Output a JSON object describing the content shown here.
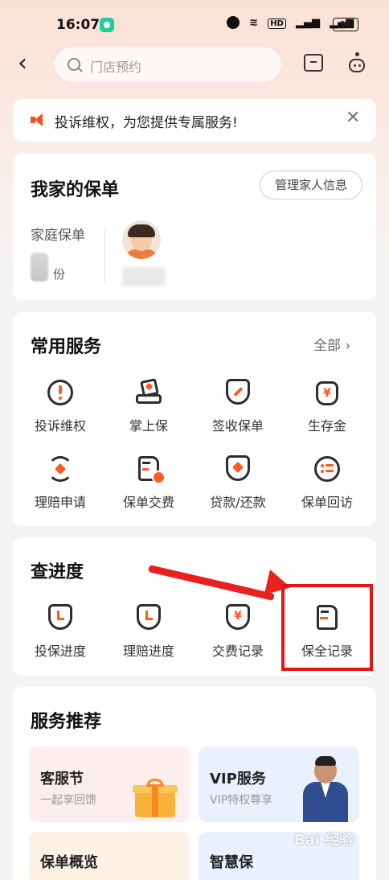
{
  "status": {
    "time": "16:07",
    "battery": "96",
    "net_label": "HD"
  },
  "nav": {
    "search_placeholder": "门店预约"
  },
  "notice": {
    "text": "投诉维权，为您提供专属服务!"
  },
  "policy": {
    "title": "我家的保单",
    "manage_label": "管理家人信息",
    "family_label": "家庭保单",
    "count_unit": "份"
  },
  "common": {
    "title": "常用服务",
    "all_label": "全部",
    "items": [
      {
        "label": "投诉维权",
        "icon": "alert-circle-icon"
      },
      {
        "label": "掌上保",
        "icon": "hand-document-icon"
      },
      {
        "label": "签收保单",
        "icon": "shield-pen-icon"
      },
      {
        "label": "生存金",
        "icon": "money-bag-icon"
      },
      {
        "label": "理赔申请",
        "icon": "refresh-claim-icon"
      },
      {
        "label": "保单交费",
        "icon": "document-pay-icon"
      },
      {
        "label": "贷款/还款",
        "icon": "shield-loan-icon"
      },
      {
        "label": "保单回访",
        "icon": "list-circle-icon"
      }
    ]
  },
  "progress": {
    "title": "查进度",
    "items": [
      {
        "label": "投保进度",
        "icon": "shield-clock-icon"
      },
      {
        "label": "理赔进度",
        "icon": "shield-clock-icon"
      },
      {
        "label": "交费记录",
        "icon": "shield-yen-icon"
      },
      {
        "label": "保全记录",
        "icon": "document-record-icon"
      }
    ]
  },
  "recommend": {
    "title": "服务推荐",
    "tiles": [
      {
        "title": "客服节",
        "subtitle": "一起享回馈"
      },
      {
        "title": "VIP服务",
        "subtitle": "VIP特权尊享"
      },
      {
        "title": "保单概览",
        "subtitle": ""
      },
      {
        "title": "智慧保",
        "subtitle": ""
      }
    ]
  },
  "watermark": "Bai 经验",
  "colors": {
    "accent": "#ff5a1f",
    "annotation": "#e81414"
  }
}
